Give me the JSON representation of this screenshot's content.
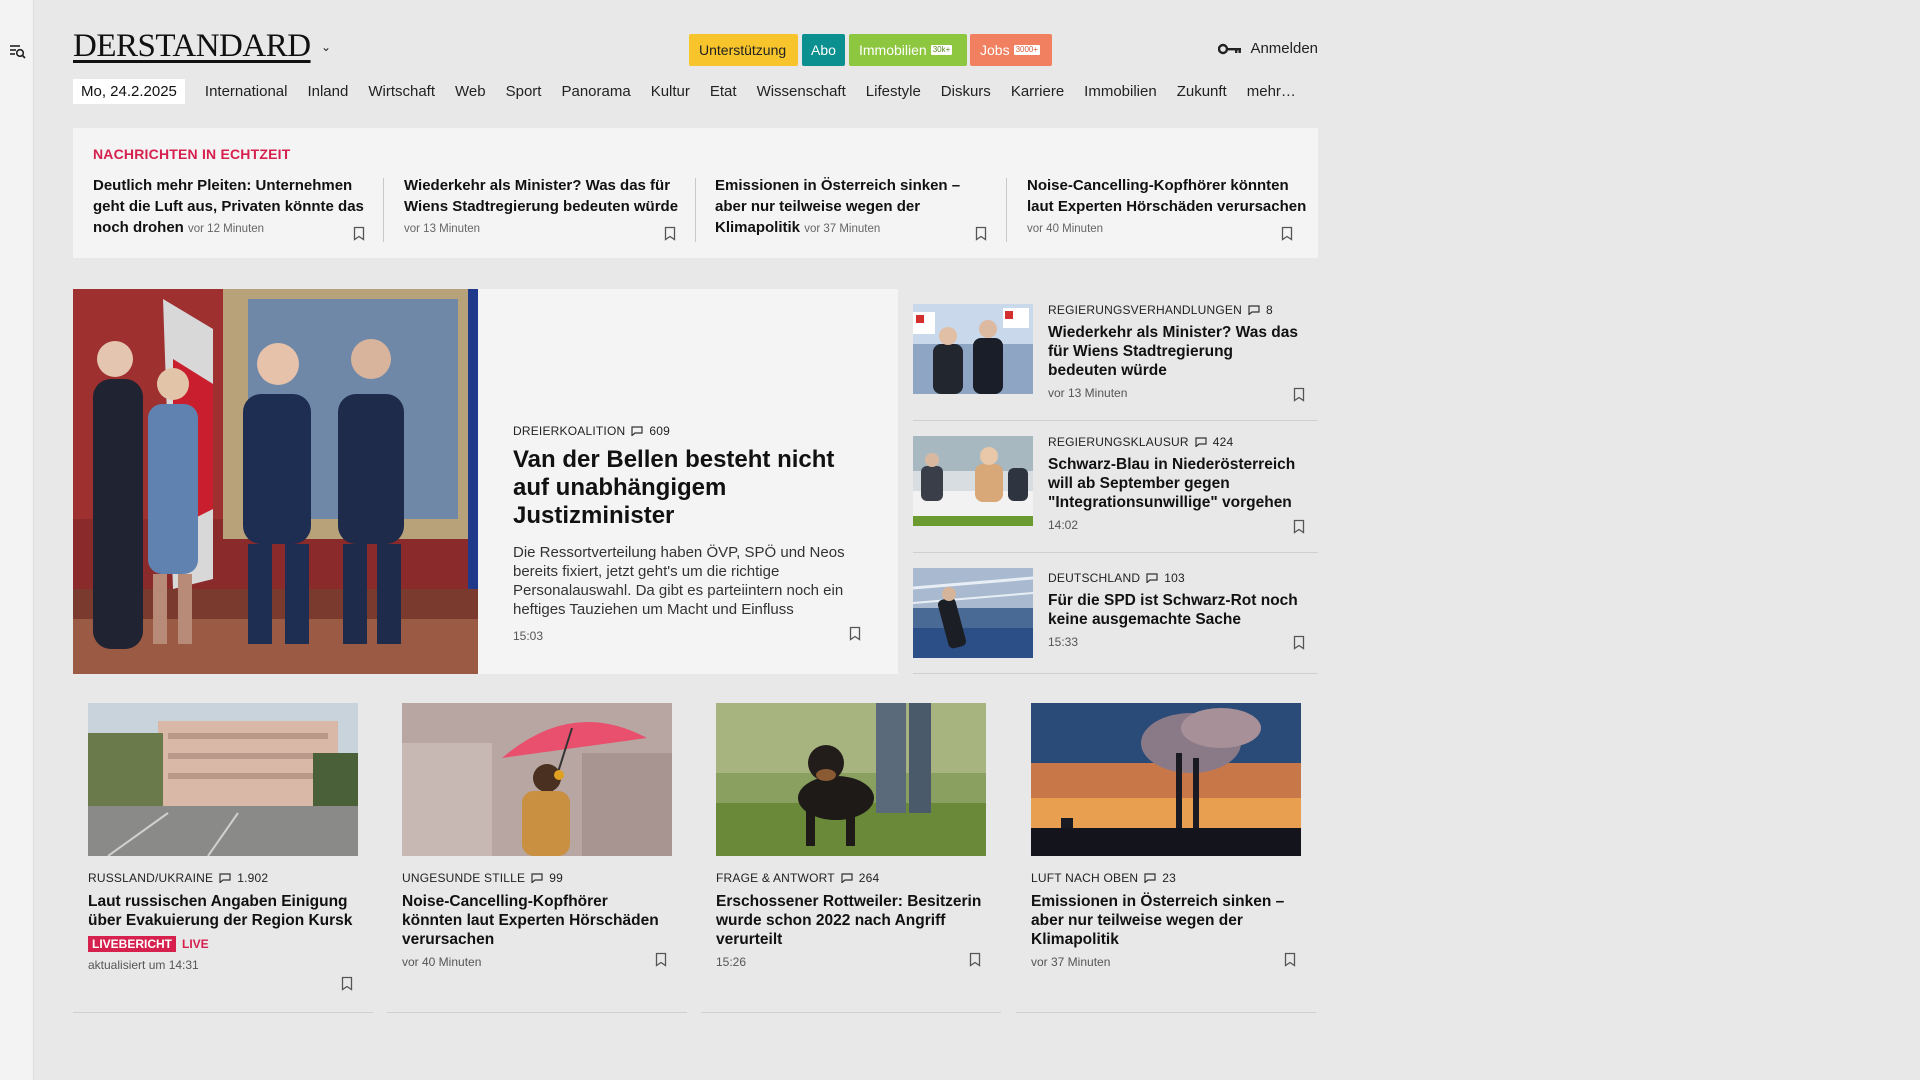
{
  "header": {
    "logo": "DERSTANDARD",
    "promos": {
      "support": "Unterstützung",
      "abo": "Abo",
      "immobilien": "Immobilien",
      "immobilien_badge": "30k+",
      "jobs": "Jobs",
      "jobs_badge": "3000+"
    },
    "login": "Anmelden"
  },
  "nav": {
    "date": "Mo, 24.2.2025",
    "items": [
      "International",
      "Inland",
      "Wirtschaft",
      "Web",
      "Sport",
      "Panorama",
      "Kultur",
      "Etat",
      "Wissenschaft",
      "Lifestyle",
      "Diskurs",
      "Karriere",
      "Immobilien",
      "Zukunft",
      "mehr…"
    ]
  },
  "ticker": {
    "title": "NACHRICHTEN IN ECHTZEIT",
    "items": [
      {
        "title": "Deutlich mehr Pleiten: Unternehmen geht die Luft aus, Privaten könnte das noch drohen",
        "time": "vor 12 Minuten"
      },
      {
        "title": "Wiederkehr als Minister? Was das für Wiens Stadtregierung bedeuten würde",
        "time": "vor 13 Minuten"
      },
      {
        "title": "Emissionen in Österreich sinken – aber nur teilweise wegen der Klimapolitik",
        "time": "vor 37 Minuten"
      },
      {
        "title": "Noise-Cancelling-Kopfhörer könnten laut Experten Hörschäden verursachen",
        "time": "vor 40 Minuten"
      }
    ]
  },
  "lead": {
    "kicker": "DREIERKOALITION",
    "comments": "609",
    "title": "Van der Bellen besteht nicht auf unabhängigem Justizminister",
    "teaser": "Die Ressortverteilung haben ÖVP, SPÖ und Neos bereits fixiert, jetzt geht's um die richtige Personalauswahl. Da gibt es parteiintern noch ein heftiges Tauziehen um Macht und Einfluss",
    "time": "15:03"
  },
  "side": [
    {
      "kicker": "REGIERUNGSVERHANDLUNGEN",
      "comments": "8",
      "title": "Wiederkehr als Minister? Was das für Wiens Stadtregierung bedeuten würde",
      "time": "vor 13 Minuten"
    },
    {
      "kicker": "REGIERUNGSKLAUSUR",
      "comments": "424",
      "title": "Schwarz-Blau in Niederösterreich will ab September gegen \"Integrationsunwillige\" vorgehen",
      "time": "14:02"
    },
    {
      "kicker": "DEUTSCHLAND",
      "comments": "103",
      "title": "Für die SPD ist Schwarz-Rot noch keine ausgemachte Sache",
      "time": "15:33"
    }
  ],
  "cards": [
    {
      "kicker": "RUSSLAND/UKRAINE",
      "comments": "1.902",
      "title": "Laut russischen Angaben Einigung über Evakuierung der Region Kursk",
      "live_badge": "LIVEBERICHT",
      "live_text": "LIVE",
      "time": "aktualisiert um 14:31"
    },
    {
      "kicker": "UNGESUNDE STILLE",
      "comments": "99",
      "title": "Noise-Cancelling-Kopfhörer könnten laut Experten Hörschäden verursachen",
      "time": "vor 40 Minuten"
    },
    {
      "kicker": "FRAGE & ANTWORT",
      "comments": "264",
      "title": "Erschossener Rottweiler: Besitzerin wurde schon 2022 nach Angriff verurteilt",
      "time": "15:26"
    },
    {
      "kicker": "LUFT NACH OBEN",
      "comments": "23",
      "title": "Emissionen in Österreich sinken – aber nur teilweise wegen der Klimapolitik",
      "time": "vor 37 Minuten"
    }
  ],
  "colors": {
    "accent_red": "#d6204e",
    "abo_teal": "#0b8f8f",
    "support_yellow": "#f7c52b",
    "immo_green": "#8dc63f",
    "jobs_orange": "#f08060"
  }
}
